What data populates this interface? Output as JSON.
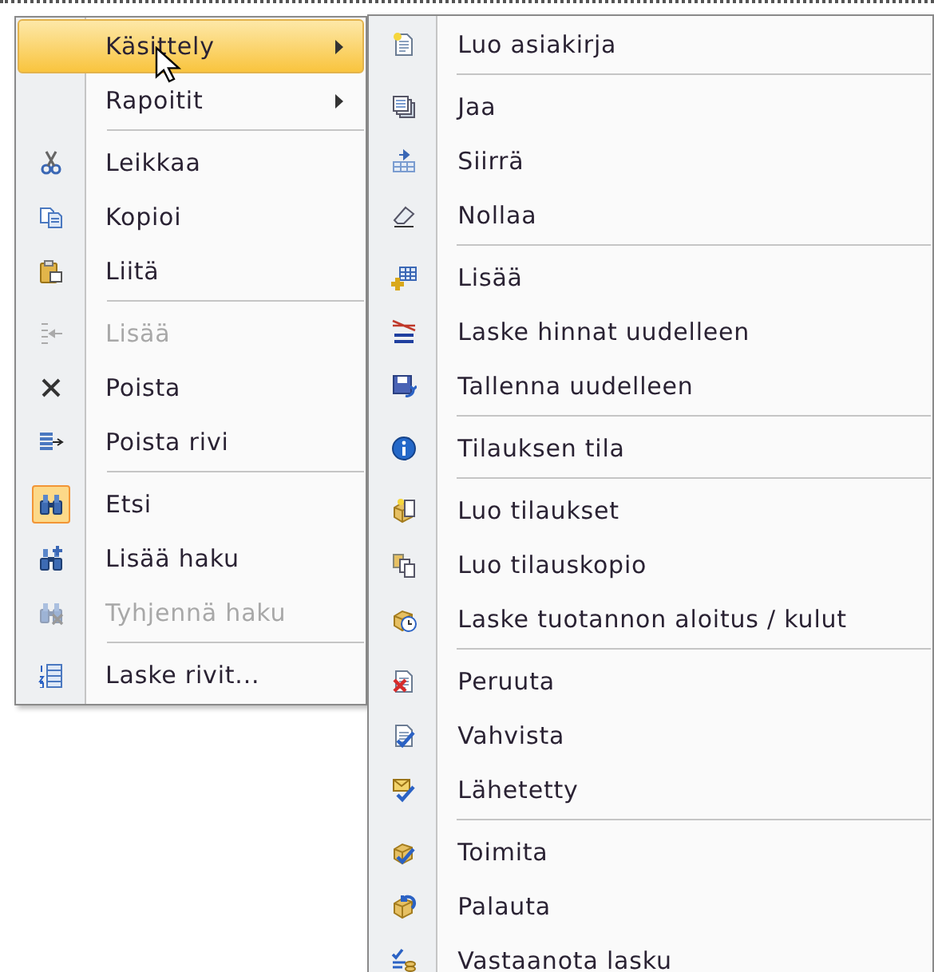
{
  "context_menu": {
    "groups": [
      [
        {
          "label": "Käsittely",
          "selected": true,
          "disabled": false,
          "checked": false,
          "submenu": true
        },
        {
          "label": "Rapoitit",
          "selected": false,
          "disabled": false,
          "checked": false,
          "submenu": true
        }
      ],
      [
        {
          "label": "Leikkaa",
          "selected": false,
          "disabled": false,
          "checked": false,
          "submenu": false
        },
        {
          "label": "Kopioi",
          "selected": false,
          "disabled": false,
          "checked": false,
          "submenu": false
        },
        {
          "label": "Liitä",
          "selected": false,
          "disabled": false,
          "checked": false,
          "submenu": false
        }
      ],
      [
        {
          "label": "Lisää",
          "selected": false,
          "disabled": true,
          "checked": false,
          "submenu": false
        },
        {
          "label": "Poista",
          "selected": false,
          "disabled": false,
          "checked": false,
          "submenu": false
        },
        {
          "label": "Poista rivi",
          "selected": false,
          "disabled": false,
          "checked": false,
          "submenu": false
        }
      ],
      [
        {
          "label": "Etsi",
          "selected": false,
          "disabled": false,
          "checked": true,
          "submenu": false
        },
        {
          "label": "Lisää haku",
          "selected": false,
          "disabled": false,
          "checked": false,
          "submenu": false
        },
        {
          "label": "Tyhjennä haku",
          "selected": false,
          "disabled": true,
          "checked": false,
          "submenu": false
        }
      ],
      [
        {
          "label": "Laske rivit...",
          "selected": false,
          "disabled": false,
          "checked": false,
          "submenu": false
        }
      ]
    ]
  },
  "submenu": {
    "groups": [
      [
        {
          "label": "Luo asiakirja",
          "selected": false
        }
      ],
      [
        {
          "label": "Jaa",
          "selected": false
        },
        {
          "label": "Siirrä",
          "selected": false
        },
        {
          "label": "Nollaa",
          "selected": false
        }
      ],
      [
        {
          "label": "Lisää",
          "selected": false
        },
        {
          "label": "Laske hinnat uudelleen",
          "selected": false
        },
        {
          "label": "Tallenna uudelleen",
          "selected": false
        }
      ],
      [
        {
          "label": "Tilauksen tila",
          "selected": false
        }
      ],
      [
        {
          "label": "Luo tilaukset",
          "selected": false
        },
        {
          "label": "Luo tilauskopio",
          "selected": false
        },
        {
          "label": "Laske tuotannon aloitus / kulut",
          "selected": false
        }
      ],
      [
        {
          "label": "Peruuta",
          "selected": false
        },
        {
          "label": "Vahvista",
          "selected": false
        },
        {
          "label": "Lähetetty",
          "selected": false
        }
      ],
      [
        {
          "label": "Toimita",
          "selected": false
        },
        {
          "label": "Palauta",
          "selected": false
        },
        {
          "label": "Vastaanota lasku",
          "selected": false
        }
      ]
    ]
  }
}
